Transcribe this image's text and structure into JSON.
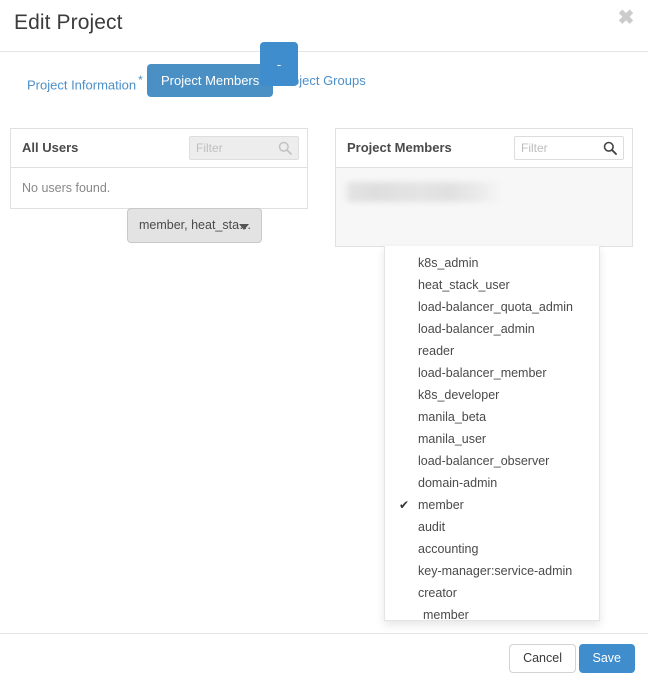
{
  "modal": {
    "title": "Edit Project",
    "close_label": "✖"
  },
  "tabs": [
    {
      "label": "Project Information",
      "required_marker": "*",
      "active": false
    },
    {
      "label": "Project Members",
      "required_marker": "",
      "active": true
    },
    {
      "label": "Project Groups",
      "required_marker": "",
      "active": false
    }
  ],
  "all_users_panel": {
    "title": "All Users",
    "filter_placeholder": "Filter",
    "filter_value": "",
    "empty_message": "No users found.",
    "search_icon": "search-icon",
    "filter_disabled": true
  },
  "project_members_panel": {
    "title": "Project Members",
    "filter_placeholder": "Filter",
    "filter_value": "",
    "search_icon": "search-icon",
    "member_name_redacted": "",
    "role_dropdown_label": "member, heat_sta…",
    "remove_button_label": "-"
  },
  "role_menu": {
    "items": [
      {
        "label": "k8s_admin",
        "checked": false,
        "indented": false
      },
      {
        "label": "heat_stack_user",
        "checked": false,
        "indented": false
      },
      {
        "label": "load-balancer_quota_admin",
        "checked": false,
        "indented": false
      },
      {
        "label": "load-balancer_admin",
        "checked": false,
        "indented": false
      },
      {
        "label": "reader",
        "checked": false,
        "indented": false
      },
      {
        "label": "load-balancer_member",
        "checked": false,
        "indented": false
      },
      {
        "label": "k8s_developer",
        "checked": false,
        "indented": false
      },
      {
        "label": "manila_beta",
        "checked": false,
        "indented": false
      },
      {
        "label": "manila_user",
        "checked": false,
        "indented": false
      },
      {
        "label": "load-balancer_observer",
        "checked": false,
        "indented": false
      },
      {
        "label": "domain-admin",
        "checked": false,
        "indented": false
      },
      {
        "label": "member",
        "checked": true,
        "indented": false
      },
      {
        "label": "audit",
        "checked": false,
        "indented": false
      },
      {
        "label": "accounting",
        "checked": false,
        "indented": false
      },
      {
        "label": "key-manager:service-admin",
        "checked": false,
        "indented": false
      },
      {
        "label": "creator",
        "checked": false,
        "indented": false
      },
      {
        "label": "member",
        "checked": false,
        "indented": true
      }
    ],
    "check_glyph": "✔"
  },
  "footer": {
    "cancel_label": "Cancel",
    "save_label": "Save"
  },
  "colors": {
    "accent": "#3f8dcc",
    "tab_active_bg": "#4a90c4",
    "link": "#4d90c9"
  }
}
